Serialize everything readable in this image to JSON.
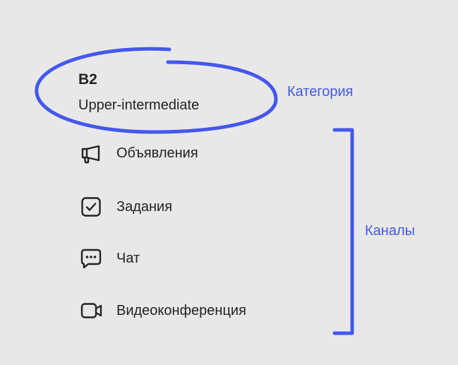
{
  "category": {
    "code": "B2",
    "name": "Upper-intermediate"
  },
  "annotations": {
    "category_label": "Категория",
    "channels_label": "Каналы",
    "accent_color": "#4457f0"
  },
  "channels": [
    {
      "label": "Объявления",
      "icon": "megaphone-icon"
    },
    {
      "label": "Задания",
      "icon": "checkbox-icon"
    },
    {
      "label": "Чат",
      "icon": "chat-bubble-icon"
    },
    {
      "label": "Видеоконференция",
      "icon": "video-camera-icon"
    }
  ]
}
